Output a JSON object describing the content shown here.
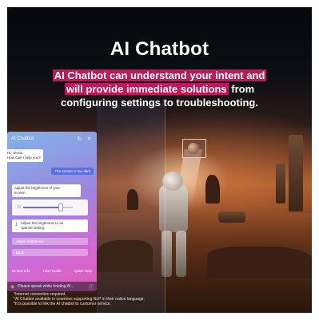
{
  "headline": "AI Chatbot",
  "subtitle": {
    "highlight_1": "AI Chatbot can understand your intent and",
    "highlight_2": "will provide immediate solutions",
    "rest_2": " from",
    "line_3": "configuring settings to troubleshooting."
  },
  "panel": {
    "title": "AI Chatbot",
    "icons": [
      "refresh-icon",
      "close-icon"
    ],
    "greeting_1": "Hi, Jenna.",
    "greeting_2": "How Can I help you?",
    "user_message": "The screen is too dark",
    "bot_reply_1": "Adjust the brightness of your",
    "bot_reply_2": "screen.",
    "brightness_level": 0.75,
    "option_number": "1",
    "option_1": "Adjust the brightness to an",
    "option_2": "optimal setting.",
    "button_1": "Adjust brightness",
    "button_2": "Back",
    "footer": [
      "Device Info",
      "User Guide",
      "Quick Help"
    ],
    "voice_prompt": "Please speak while holding AI...",
    "accent": "#c2185b"
  },
  "notes": [
    "*Internet connection required.",
    "*AI Chatbot available in countries supporting NLP in their native language.",
    "*It is possible to link the AI chatbot to customer service."
  ]
}
